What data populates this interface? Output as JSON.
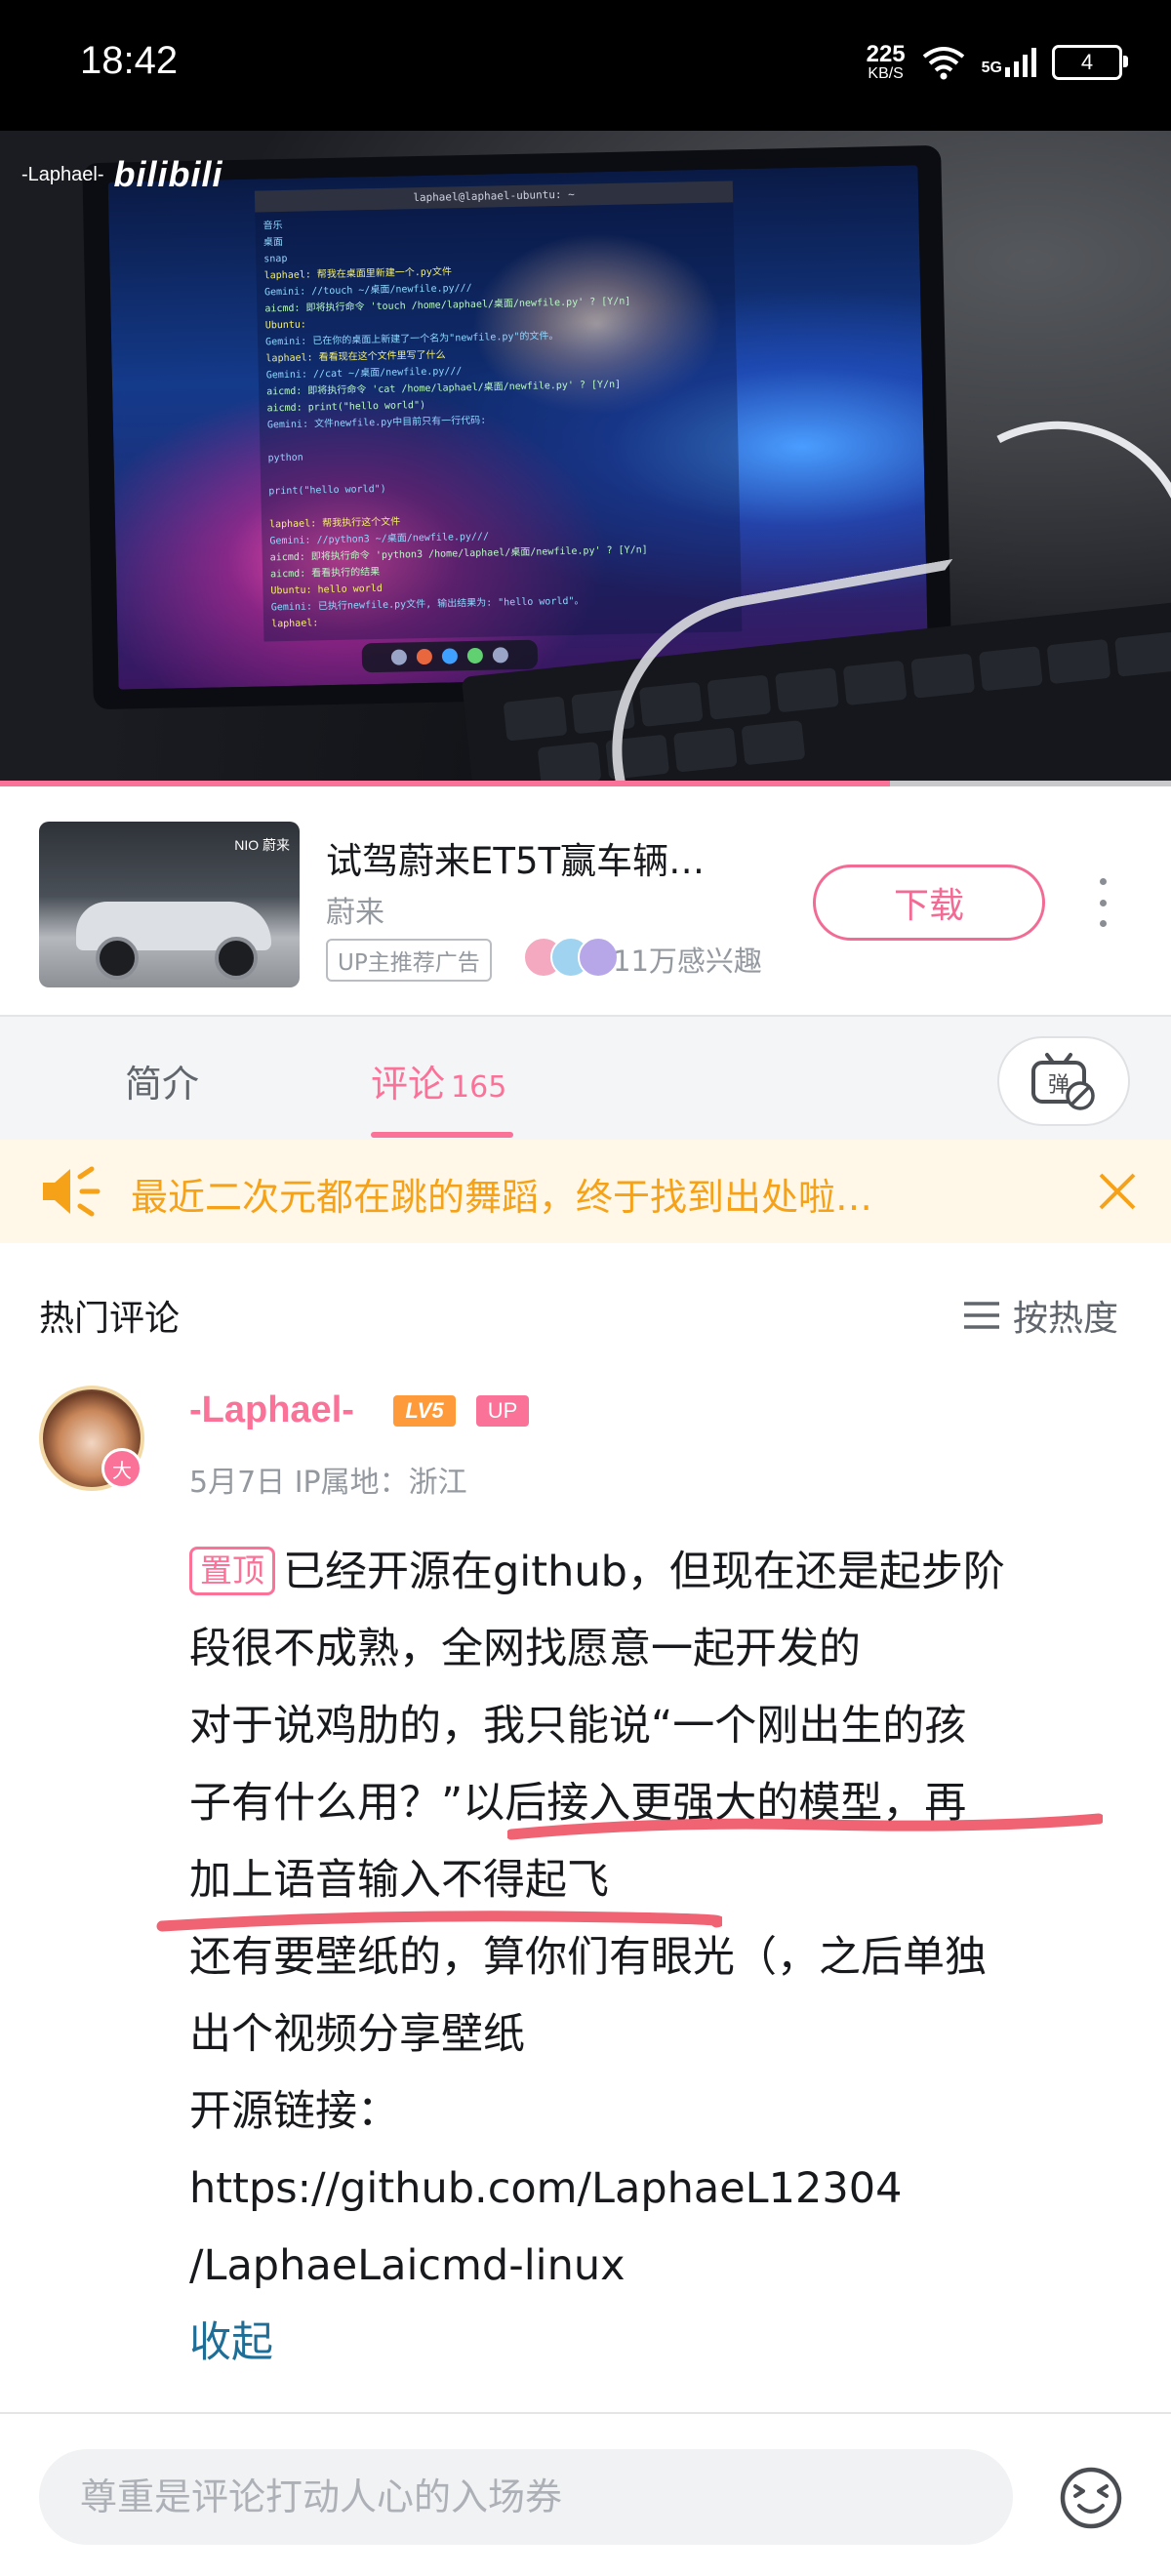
{
  "status_bar": {
    "time": "18:42",
    "net_speed_value": "225",
    "net_speed_unit": "KB/S",
    "network_type": "5G",
    "battery": "4"
  },
  "video": {
    "watermark_user": "-Laphael-",
    "watermark_logo": "bilibili",
    "terminal_title": "laphael@laphael-ubuntu: ~",
    "terminal_lines": [
      "音乐",
      "桌面",
      "snap",
      "laphael: 帮我在桌面里新建一个.py文件",
      "Gemini: //touch ~/桌面/newfile.py///",
      "aicmd: 即将执行命令 'touch /home/laphael/桌面/newfile.py' ? [Y/n]",
      "Ubuntu:",
      "Gemini: 已在你的桌面上新建了一个名为\"newfile.py\"的文件。",
      "laphael: 看看现在这个文件里写了什么",
      "Gemini: //cat ~/桌面/newfile.py///",
      "aicmd: 即将执行命令 'cat /home/laphael/桌面/newfile.py' ? [Y/n]",
      "aicmd: print(\"hello world\")",
      "Gemini: 文件newfile.py中目前只有一行代码:",
      "",
      "python",
      "",
      "print(\"hello world\")",
      "",
      "laphael: 帮我执行这个文件",
      "Gemini: //python3 ~/桌面/newfile.py///",
      "aicmd: 即将执行命令 'python3 /home/laphael/桌面/newfile.py' ? [Y/n]",
      "aicmd: 看看执行的结果",
      "Ubuntu: hello world",
      "Gemini: 已执行newfile.py文件, 输出结果为: \"hello world\"。",
      "laphael: "
    ],
    "progress": 0.76
  },
  "ad": {
    "title": "试驾蔚来ET5T赢车辆…",
    "brand": "蔚来",
    "badge": "UP主推荐广告",
    "interest": "11万感兴趣",
    "download_label": "下载",
    "thumb_tag": "NIO 蔚来",
    "avatar_colors": [
      "#f4a9c0",
      "#9fd3f0",
      "#b7a7e8"
    ]
  },
  "tabs": {
    "intro_label": "简介",
    "comments_label": "评论",
    "comments_count": "165",
    "danmaku_icon": "danmaku-off-icon"
  },
  "notice": {
    "text": "最近二次元都在跳的舞蹈，终于找到出处啦…",
    "icon": "speaker-icon",
    "color": "#f6a219"
  },
  "comments_section": {
    "title": "热门评论",
    "sort_label": "按热度"
  },
  "comment": {
    "username": "-Laphael-",
    "level": "LV5",
    "up_badge": "UP",
    "avatar_badge": "大",
    "meta": "5月7日  IP属地：浙江",
    "pinned_label": "置顶",
    "lines": [
      "已经开源在github，但现在还是起步阶",
      "段很不成熟，全网找愿意一起开发的",
      "对于说鸡肋的，我只能说“一个刚出生的孩",
      "子有什么用？”以后接入更强大的模型，再",
      "加上语音输入不得起飞",
      "还有要壁纸的，算你们有眼光（，之后单独",
      "出个视频分享壁纸",
      "开源链接：",
      "https://github.com/LaphaeL12304",
      "/LaphaeLaicmd-linux"
    ],
    "collapse_label": "收起"
  },
  "bottom_bar": {
    "placeholder": "尊重是评论打动人心的入场券",
    "emoji_icon": "emoji-icon"
  },
  "colors": {
    "accent": "#fb7299",
    "link": "#1f6e97",
    "muted": "#9499a0"
  }
}
